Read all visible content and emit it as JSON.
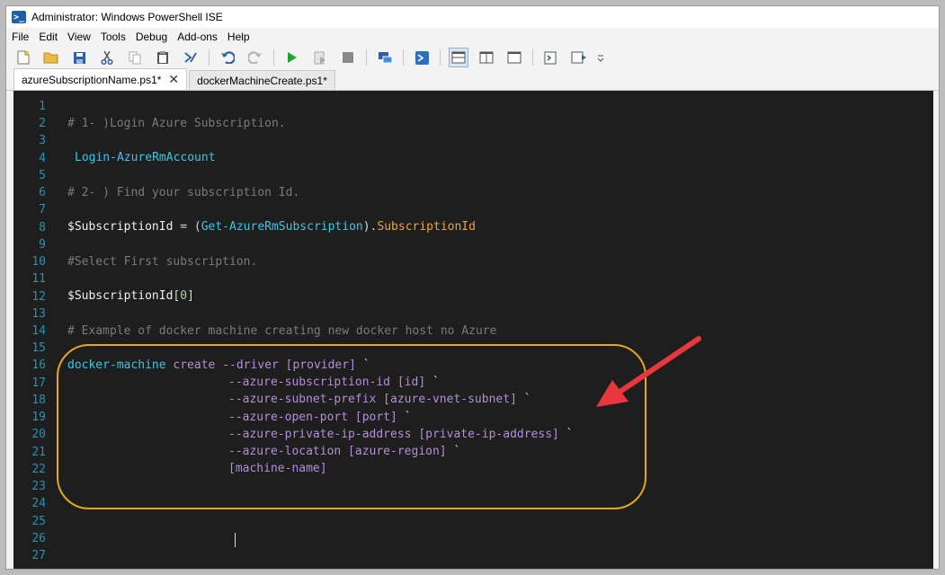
{
  "window": {
    "title": "Administrator: Windows PowerShell ISE",
    "logo_glyph": ">_"
  },
  "menu": [
    "File",
    "Edit",
    "View",
    "Tools",
    "Debug",
    "Add-ons",
    "Help"
  ],
  "toolbar": {
    "icons": [
      "new-icon",
      "open-icon",
      "save-icon",
      "cut-icon",
      "copy-icon",
      "paste-icon",
      "clear-icon",
      "undo-icon",
      "redo-icon",
      "run-icon",
      "run-selection-icon",
      "stop-icon",
      "remote-icon",
      "powershell-icon",
      "layout-top-icon",
      "layout-right-icon",
      "layout-max-icon",
      "show-script-icon",
      "show-commands-icon",
      "overflow-icon"
    ]
  },
  "tabs": [
    {
      "label": "azureSubscriptionName.ps1*",
      "active": true,
      "close": "✕"
    },
    {
      "label": "dockerMachineCreate.ps1*",
      "active": false
    }
  ],
  "editor": {
    "line_numbers": [
      "1",
      "2",
      "3",
      "4",
      "5",
      "6",
      "7",
      "8",
      "9",
      "10",
      "11",
      "12",
      "13",
      "14",
      "15",
      "16",
      "17",
      "18",
      "19",
      "20",
      "21",
      "22",
      "23",
      "24",
      "25",
      "26",
      "27"
    ],
    "lines": {
      "l2": "# 1- )Login Azure Subscription.",
      "l4": "Login-AzureRmAccount",
      "l6": "# 2- ) Find your subscription Id.",
      "l8_var": "$SubscriptionId",
      "l8_eq": " = (",
      "l8_cmd": "Get-AzureRmSubscription",
      "l8_close": ").",
      "l8_prop": "SubscriptionId",
      "l10": "#Select First subscription.",
      "l12_var": "$SubscriptionId",
      "l12_open": "[",
      "l12_num": "0",
      "l12_close": "]",
      "l14": "# Example of docker machine creating new docker host no Azure",
      "l16_cmd": "docker-machine",
      "l16_args": " create --driver [provider]",
      "l17_args": "--azure-subscription-id [id]",
      "l18_args": "--azure-subnet-prefix [azure-vnet-subnet]",
      "l19_args": "--azure-open-port [port]",
      "l20_args": "--azure-private-ip-address [private-ip-address]",
      "l21_args": "--azure-location [azure-region]",
      "l22_args": "[machine-name]",
      "tick": " `"
    },
    "highlight_color": "#e6a818",
    "arrow_color": "#e8383d"
  }
}
